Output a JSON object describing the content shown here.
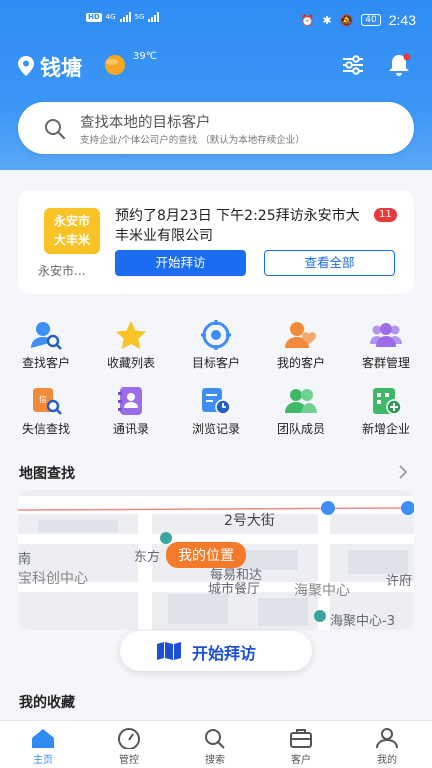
{
  "status_bar": {
    "time": "2:43",
    "battery": "40",
    "network": "4G",
    "network2": "5G"
  },
  "header": {
    "city": "钱塘",
    "temperature": "39℃"
  },
  "search": {
    "title": "查找本地的目标客户",
    "subtitle": "支持企业/个体公司户的查找 （默认为本地存续企业）"
  },
  "visit_card": {
    "badge_line1": "永安市",
    "badge_line2": "大丰米",
    "badge_caption": "永安市...",
    "message": "预约了8月23日 下午2:25拜访永安市大丰米业有限公司",
    "count": "11",
    "start_button": "开始拜访",
    "view_all_button": "查看全部"
  },
  "grid": [
    {
      "label": "查找客户",
      "icon": "find-customer-icon",
      "color": "#3d8ef5"
    },
    {
      "label": "收藏列表",
      "icon": "star-icon",
      "color": "#f7c325"
    },
    {
      "label": "目标客户",
      "icon": "target-icon",
      "color": "#3d8ef5"
    },
    {
      "label": "我的客户",
      "icon": "my-customer-icon",
      "color": "#f28a3a"
    },
    {
      "label": "客群管理",
      "icon": "group-icon",
      "color": "#9b6ee8"
    },
    {
      "label": "失信查找",
      "icon": "dishonest-search-icon",
      "color": "#f28a3a"
    },
    {
      "label": "通讯录",
      "icon": "contacts-icon",
      "color": "#9b6ee8"
    },
    {
      "label": "浏览记录",
      "icon": "history-icon",
      "color": "#3d8ef5"
    },
    {
      "label": "团队成员",
      "icon": "team-icon",
      "color": "#3fb86a"
    },
    {
      "label": "新增企业",
      "icon": "new-company-icon",
      "color": "#3fb86a"
    }
  ],
  "map_section": {
    "title": "地图查找",
    "my_position": "我的位置",
    "labels": [
      "2号大街",
      "东方",
      "宝科创中心",
      "海聚中心",
      "许府",
      "城市餐厅",
      "海聚中心-3",
      "南",
      "每易和达"
    ]
  },
  "visit_button": "开始拜访",
  "favorites_title": "我的收藏",
  "nav": [
    {
      "label": "主页",
      "icon": "home-icon",
      "active": true
    },
    {
      "label": "管控",
      "icon": "dashboard-icon",
      "active": false
    },
    {
      "label": "搜索",
      "icon": "search-icon",
      "active": false
    },
    {
      "label": "客户",
      "icon": "briefcase-icon",
      "active": false
    },
    {
      "label": "我的",
      "icon": "profile-icon",
      "active": false
    }
  ]
}
